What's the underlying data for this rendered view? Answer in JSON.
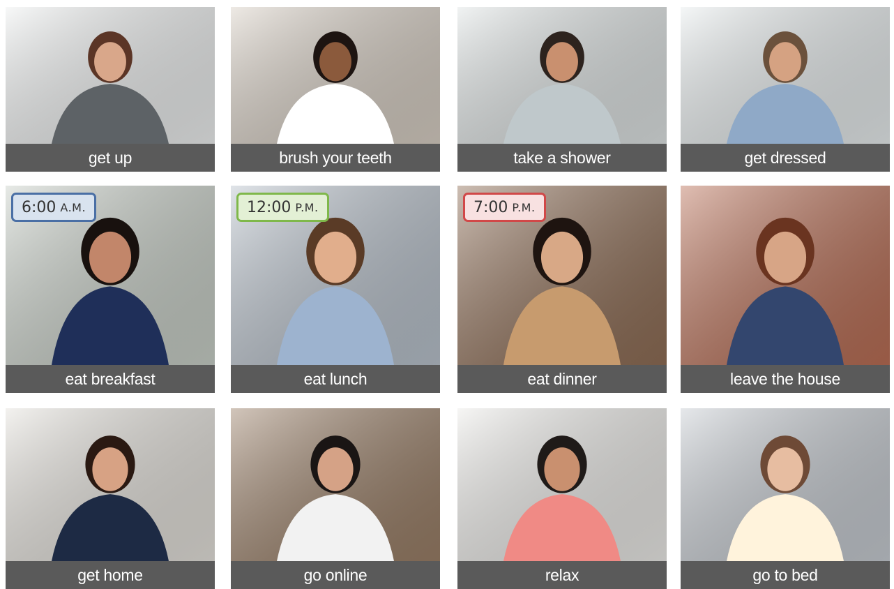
{
  "cards": [
    {
      "caption": "get up",
      "bg": "#eef0f0",
      "accent": "#5d6266",
      "skin": "#d9a78a",
      "hair": "#5b3526"
    },
    {
      "caption": "brush your teeth",
      "bg": "#d8cfc4",
      "accent": "#ffffff",
      "skin": "#8b5a3c",
      "hair": "#1d1411"
    },
    {
      "caption": "take a shower",
      "bg": "#dfe4e4",
      "accent": "#bfc8cb",
      "skin": "#c9906f",
      "hair": "#2d231e"
    },
    {
      "caption": "get dressed",
      "bg": "#e8edee",
      "accent": "#8fa9c7",
      "skin": "#d5a282",
      "hair": "#6b513c"
    },
    {
      "caption": "eat breakfast",
      "bg": "#c9d0c8",
      "accent": "#1f2f59",
      "skin": "#c2866a",
      "hair": "#18110e",
      "time": "6:00",
      "ampm": "A.M.",
      "badge_bg": "#d9e3ef",
      "badge_border": "#4a6fa5"
    },
    {
      "caption": "eat lunch",
      "bg": "#b9c2cc",
      "accent": "#9db3cf",
      "skin": "#e1ae8c",
      "hair": "#5a3b26",
      "time": "12:00",
      "ampm": "P.M.",
      "badge_bg": "#e3f0d5",
      "badge_border": "#7fb84a"
    },
    {
      "caption": "eat dinner",
      "bg": "#8f6e56",
      "accent": "#c79b6e",
      "skin": "#d8a886",
      "hair": "#1e1410",
      "time": "7:00",
      "ampm": "P.M.",
      "badge_bg": "#f8e1e1",
      "badge_border": "#d14848"
    },
    {
      "caption": "leave the house",
      "bg": "#b96e55",
      "accent": "#33466e",
      "skin": "#d7a586",
      "hair": "#6a3420"
    },
    {
      "caption": "get home",
      "bg": "#e5e2dc",
      "accent": "#1d2a44",
      "skin": "#d7a284",
      "hair": "#2a1912"
    },
    {
      "caption": "go online",
      "bg": "#9a7f67",
      "accent": "#f2f2f2",
      "skin": "#d5a286",
      "hair": "#1a1514"
    },
    {
      "caption": "relax",
      "bg": "#ecebe8",
      "accent": "#f08a85",
      "skin": "#c9906f",
      "hair": "#1f1a18"
    },
    {
      "caption": "go to bed",
      "bg": "#c7ccd2",
      "accent": "#fff3dc",
      "skin": "#e7bda1",
      "hair": "#6e4a36"
    }
  ]
}
